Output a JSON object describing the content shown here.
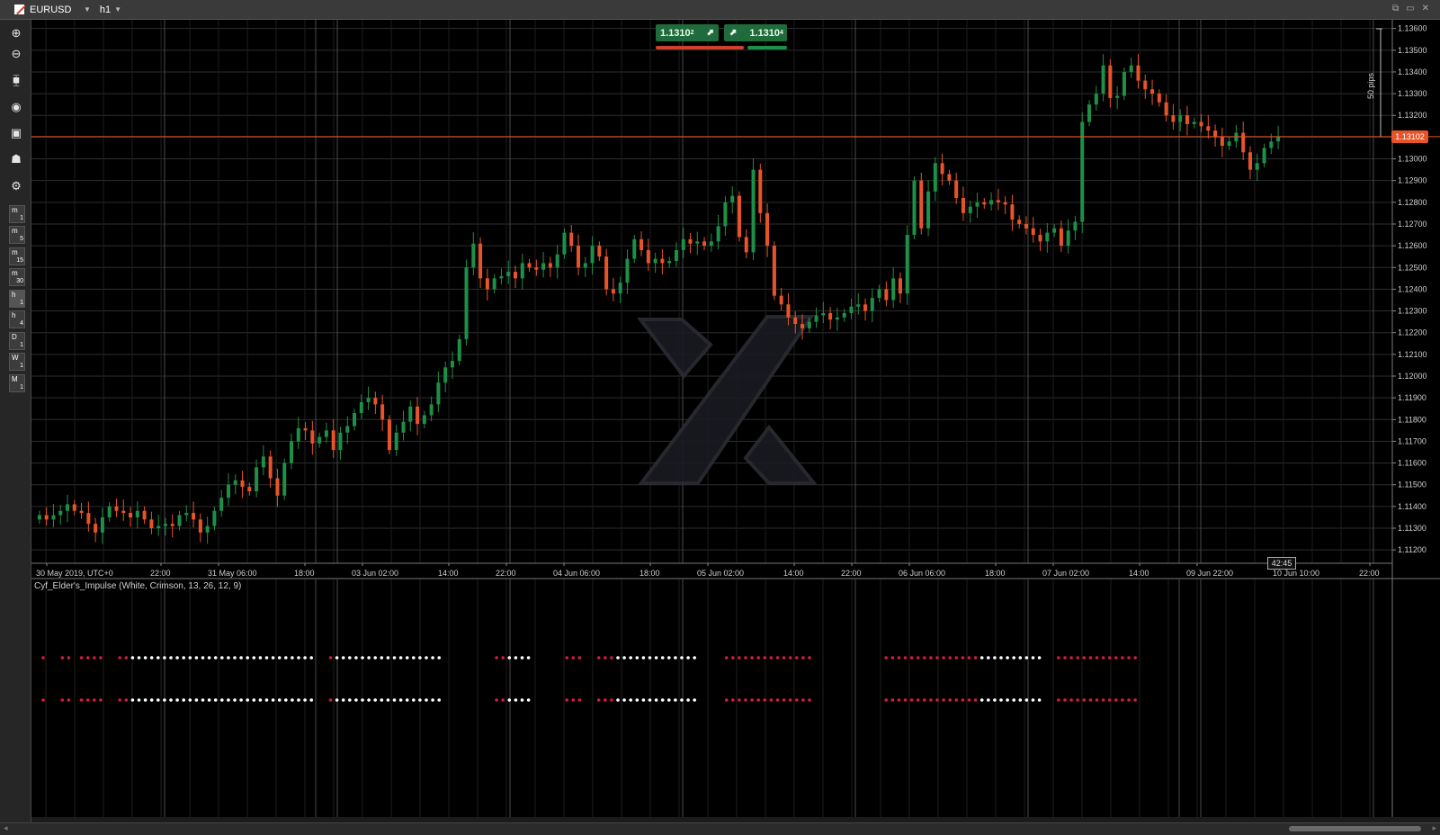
{
  "window": {
    "symbol": "EURUSD",
    "timeframe": "h1",
    "win_buttons": [
      "⧉",
      "▭",
      "✕"
    ]
  },
  "toolbar": {
    "tools": [
      {
        "icon": "zoom-in-icon",
        "glyph": "⊕"
      },
      {
        "icon": "zoom-out-icon",
        "glyph": "⊖"
      },
      {
        "icon": "candles-icon",
        "glyph": "⧯"
      },
      {
        "icon": "compass-icon",
        "glyph": "◉"
      },
      {
        "icon": "bot-icon",
        "glyph": "▣"
      },
      {
        "icon": "user-icon",
        "glyph": "☗"
      },
      {
        "icon": "settings-icon",
        "glyph": "⚙"
      }
    ],
    "timeframes": [
      {
        "l": "m",
        "n": "1"
      },
      {
        "l": "m",
        "n": "5"
      },
      {
        "l": "m",
        "n": "15"
      },
      {
        "l": "m",
        "n": "30"
      },
      {
        "l": "h",
        "n": "1"
      },
      {
        "l": "h",
        "n": "4"
      },
      {
        "l": "D",
        "n": "1"
      },
      {
        "l": "W",
        "n": "1"
      },
      {
        "l": "M",
        "n": "1"
      }
    ]
  },
  "quote": {
    "sell": "1.1310",
    "sell_sup": "2",
    "buy": "1.1310",
    "buy_sup": "4"
  },
  "current_price": "1.13102",
  "pips_label": "50 pips",
  "countdown": "42:45",
  "indicator_label": "Cyf_Elder's_Impulse (White, Crimson, 13, 26, 12, 9)",
  "colors": {
    "bull": "#1e8f49",
    "bear": "#e8542a",
    "grid": "#2e2e2e",
    "bg": "#000000",
    "price_line": "#e8542a",
    "dot_white": "#ffffff",
    "dot_red": "#d81b3a"
  },
  "chart_data": {
    "type": "candlestick",
    "y_ticks": [
      "1.13600",
      "1.13500",
      "1.13400",
      "1.13300",
      "1.13200",
      "1.13100",
      "1.13000",
      "1.12900",
      "1.12800",
      "1.12700",
      "1.12600",
      "1.12500",
      "1.12400",
      "1.12300",
      "1.12200",
      "1.12100",
      "1.12000",
      "1.11900",
      "1.11800",
      "1.11700",
      "1.11600",
      "1.11500",
      "1.11400",
      "1.11300",
      "1.11200"
    ],
    "ylim": [
      1.1118,
      1.1364
    ],
    "x_labels": [
      "30 May 2019, UTC+0",
      "22:00",
      "31 May 06:00",
      "18:00",
      "03 Jun 02:00",
      "14:00",
      "22:00",
      "04 Jun 06:00",
      "18:00",
      "05 Jun 02:00",
      "14:00",
      "22:00",
      "06 Jun 06:00",
      "18:00",
      "07 Jun 02:00",
      "14:00",
      "09 Jun 22:00",
      "10 Jun 10:00",
      "22:00"
    ],
    "closes": [
      1.1136,
      1.1134,
      1.1136,
      1.1138,
      1.1141,
      1.1138,
      1.1137,
      1.1132,
      1.1128,
      1.1135,
      1.114,
      1.1138,
      1.1137,
      1.1135,
      1.1138,
      1.1134,
      1.113,
      1.1131,
      1.1132,
      1.1131,
      1.1136,
      1.1137,
      1.1134,
      1.1128,
      1.1131,
      1.1138,
      1.1144,
      1.115,
      1.1152,
      1.1149,
      1.1147,
      1.1158,
      1.1163,
      1.1153,
      1.1145,
      1.116,
      1.117,
      1.1176,
      1.1175,
      1.1169,
      1.1172,
      1.1175,
      1.1166,
      1.1174,
      1.1177,
      1.1183,
      1.1188,
      1.119,
      1.1187,
      1.118,
      1.1166,
      1.1174,
      1.1179,
      1.1186,
      1.1178,
      1.1182,
      1.1187,
      1.1197,
      1.1204,
      1.1207,
      1.1217,
      1.125,
      1.1261,
      1.1245,
      1.124,
      1.1245,
      1.1246,
      1.1248,
      1.1245,
      1.1252,
      1.125,
      1.1249,
      1.1252,
      1.125,
      1.1256,
      1.1266,
      1.126,
      1.125,
      1.1252,
      1.126,
      1.1255,
      1.124,
      1.1238,
      1.1243,
      1.1254,
      1.1263,
      1.1258,
      1.1252,
      1.1254,
      1.1252,
      1.1253,
      1.1258,
      1.1263,
      1.1261,
      1.1262,
      1.126,
      1.1262,
      1.1269,
      1.128,
      1.1283,
      1.1264,
      1.1257,
      1.1295,
      1.1275,
      1.126,
      1.1237,
      1.1233,
      1.1227,
      1.1224,
      1.1222,
      1.1225,
      1.1228,
      1.1229,
      1.1226,
      1.1227,
      1.1229,
      1.1232,
      1.1233,
      1.123,
      1.1236,
      1.124,
      1.1235,
      1.1245,
      1.1238,
      1.1265,
      1.129,
      1.1268,
      1.1285,
      1.1298,
      1.1293,
      1.129,
      1.1282,
      1.1275,
      1.1278,
      1.128,
      1.1279,
      1.1281,
      1.128,
      1.1279,
      1.1272,
      1.127,
      1.1268,
      1.1265,
      1.1262,
      1.1266,
      1.1268,
      1.126,
      1.1267,
      1.1271,
      1.1317,
      1.1325,
      1.133,
      1.1343,
      1.1328,
      1.1329,
      1.134,
      1.1343,
      1.1336,
      1.1332,
      1.133,
      1.1326,
      1.132,
      1.1317,
      1.132,
      1.1316,
      1.1317,
      1.1315,
      1.1313,
      1.131,
      1.1306,
      1.1308,
      1.1312,
      1.1303,
      1.1295,
      1.1298,
      1.1305,
      1.1308,
      1.131
    ]
  },
  "impulse_rows": [
    [
      1,
      0,
      0,
      1,
      1,
      0,
      1,
      1,
      1,
      1,
      0,
      0,
      1,
      1,
      2,
      2,
      2,
      2,
      2,
      2,
      2,
      2,
      2,
      2,
      2,
      2,
      2,
      2,
      2,
      2,
      2,
      2,
      2,
      2,
      2,
      2,
      2,
      2,
      2,
      2,
      2,
      2,
      2,
      0,
      0,
      1,
      2,
      2,
      2,
      2,
      2,
      2,
      2,
      2,
      2,
      2,
      2,
      2,
      2,
      2,
      2,
      2,
      2,
      0,
      0,
      0,
      0,
      0,
      0,
      0,
      0,
      1,
      1,
      2,
      2,
      2,
      2,
      0,
      0,
      0,
      0,
      0,
      1,
      1,
      1,
      0,
      0,
      1,
      1,
      1,
      2,
      2,
      2,
      2,
      2,
      2,
      2,
      2,
      2,
      2,
      2,
      2,
      2,
      0,
      0,
      0,
      0,
      1,
      1,
      1,
      1,
      1,
      1,
      1,
      1,
      1,
      1,
      1,
      1,
      1,
      1,
      0,
      0,
      0,
      0,
      0,
      0,
      0,
      0,
      0,
      0,
      0,
      1,
      1,
      1,
      1,
      1,
      1,
      1,
      1,
      1,
      1,
      1,
      1,
      1,
      1,
      1,
      2,
      2,
      2,
      2,
      2,
      2,
      2,
      2,
      2,
      2,
      0,
      0,
      1,
      1,
      1,
      1,
      1,
      1,
      1,
      1,
      1,
      1,
      1,
      1,
      1
    ]
  ]
}
